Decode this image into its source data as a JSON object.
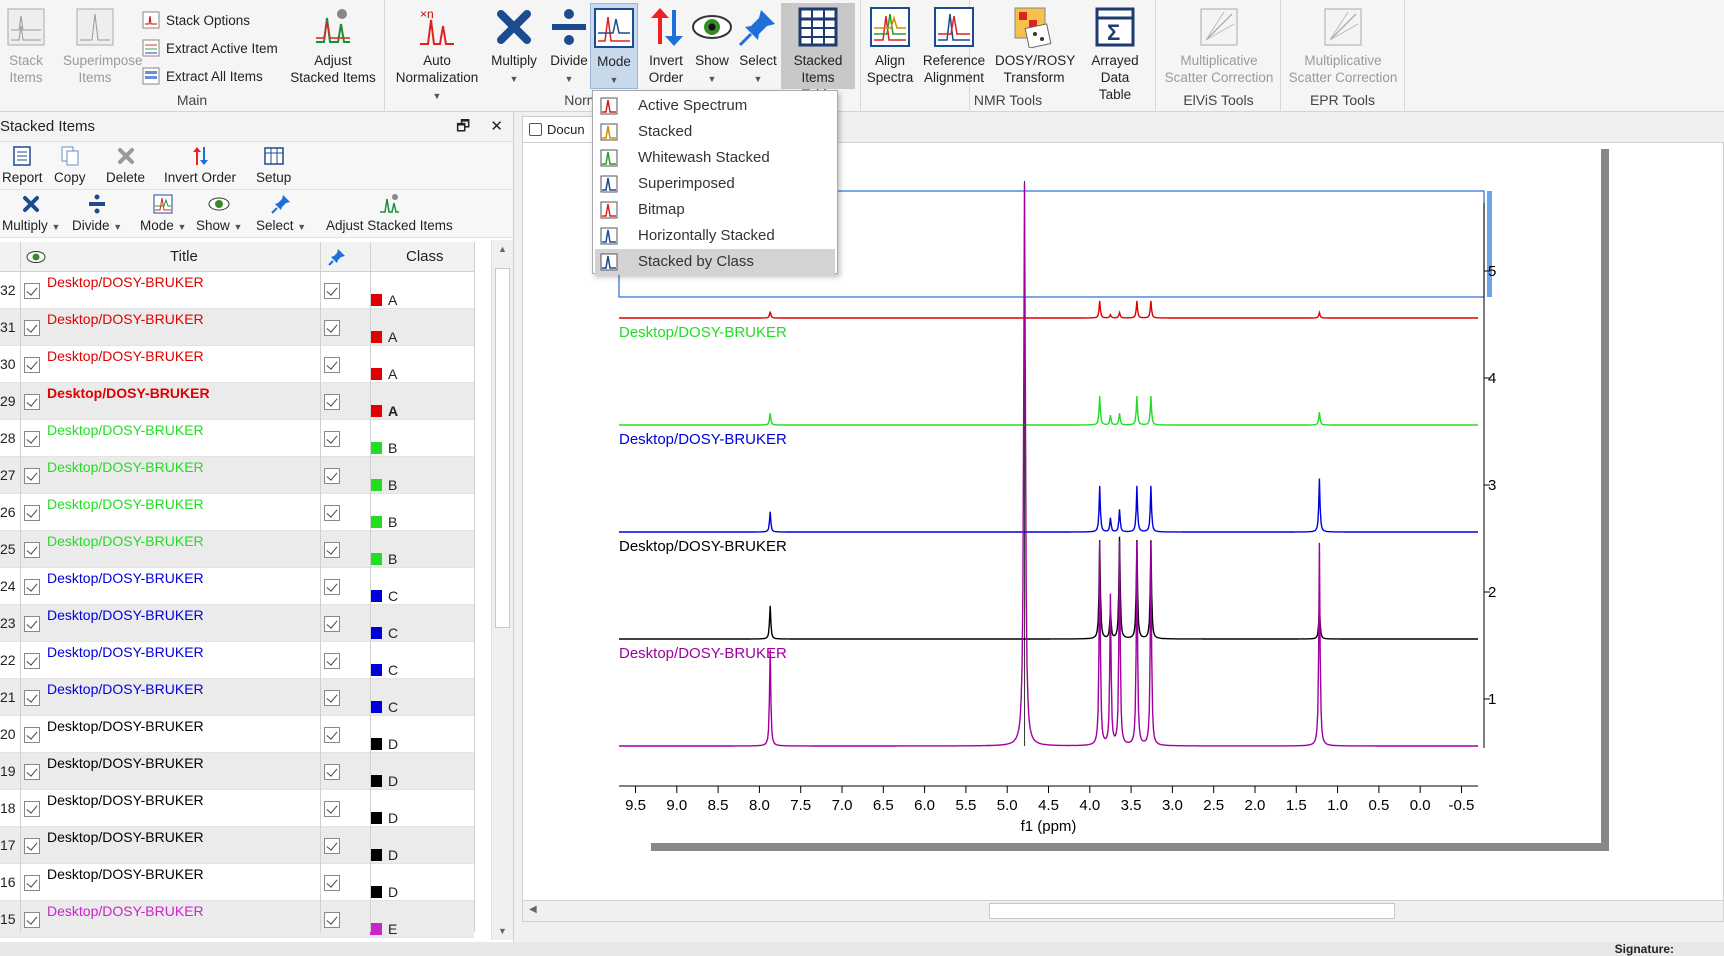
{
  "ribbon": {
    "main_group": {
      "label": "Main",
      "stack_items": "Stack Items",
      "superimpose_items": "Superimpose Items",
      "stack_options": "Stack Options",
      "extract_active_item": "Extract Active Item",
      "extract_all_items": "Extract All Items",
      "adjust_stacked_items": "Adjust Stacked Items"
    },
    "normalization_group": {
      "label": "Normalization",
      "auto_normalization": "Auto Normalization",
      "multiply": "Multiply",
      "divide": "Divide"
    },
    "mode": "Mode",
    "invert_order": "Invert Order",
    "show": "Show",
    "select": "Select",
    "stacked_items_table": "Stacked Items Table",
    "nmr_group": {
      "label": "NMR Tools",
      "align_spectra": "Align Spectra",
      "reference_alignment": "Reference Alignment",
      "dosy_rosy": "DOSY/ROSY Transform",
      "arrayed_data_table": "Arrayed Data Table"
    },
    "elvis_group": {
      "label": "ElViS Tools",
      "msc": "Multiplicative Scatter Correction"
    },
    "epr_group": {
      "label": "EPR Tools",
      "msc": "Multiplicative Scatter Correction"
    }
  },
  "mode_menu": {
    "items": [
      {
        "label": "Active Spectrum",
        "icon": "active-spectrum-icon"
      },
      {
        "label": "Stacked",
        "icon": "stacked-icon"
      },
      {
        "label": "Whitewash Stacked",
        "icon": "whitewash-stacked-icon"
      },
      {
        "label": "Superimposed",
        "icon": "superimposed-icon"
      },
      {
        "label": "Bitmap",
        "icon": "bitmap-icon"
      },
      {
        "label": "Horizontally Stacked",
        "icon": "horizontally-stacked-icon"
      },
      {
        "label": "Stacked by Class",
        "icon": "stacked-by-class-icon",
        "selected": true
      }
    ]
  },
  "panel": {
    "title": "Stacked Items",
    "toolbar1": {
      "report": "Report",
      "copy": "Copy",
      "delete": "Delete",
      "invert_order": "Invert Order",
      "setup": "Setup"
    },
    "toolbar2": {
      "multiply": "Multiply",
      "divide": "Divide",
      "mode": "Mode",
      "show": "Show",
      "select": "Select",
      "adjust": "Adjust Stacked Items"
    },
    "columns": {
      "title": "Title",
      "class": "Class"
    }
  },
  "rows": [
    {
      "num": "32",
      "title": "Desktop/DOSY-BRUKER",
      "color": "#e00000",
      "cls": "A",
      "bold": false
    },
    {
      "num": "31",
      "title": "Desktop/DOSY-BRUKER",
      "color": "#e00000",
      "cls": "A",
      "bold": false
    },
    {
      "num": "30",
      "title": "Desktop/DOSY-BRUKER",
      "color": "#e00000",
      "cls": "A",
      "bold": false
    },
    {
      "num": "29",
      "title": "Desktop/DOSY-BRUKER",
      "color": "#e00000",
      "cls": "A",
      "bold": true
    },
    {
      "num": "28",
      "title": "Desktop/DOSY-BRUKER",
      "color": "#22dd22",
      "cls": "B",
      "bold": false
    },
    {
      "num": "27",
      "title": "Desktop/DOSY-BRUKER",
      "color": "#22dd22",
      "cls": "B",
      "bold": false
    },
    {
      "num": "26",
      "title": "Desktop/DOSY-BRUKER",
      "color": "#22dd22",
      "cls": "B",
      "bold": false
    },
    {
      "num": "25",
      "title": "Desktop/DOSY-BRUKER",
      "color": "#22dd22",
      "cls": "B",
      "bold": false
    },
    {
      "num": "24",
      "title": "Desktop/DOSY-BRUKER",
      "color": "#0000dd",
      "cls": "C",
      "bold": false
    },
    {
      "num": "23",
      "title": "Desktop/DOSY-BRUKER",
      "color": "#0000dd",
      "cls": "C",
      "bold": false
    },
    {
      "num": "22",
      "title": "Desktop/DOSY-BRUKER",
      "color": "#0000dd",
      "cls": "C",
      "bold": false
    },
    {
      "num": "21",
      "title": "Desktop/DOSY-BRUKER",
      "color": "#0000dd",
      "cls": "C",
      "bold": false
    },
    {
      "num": "20",
      "title": "Desktop/DOSY-BRUKER",
      "color": "#000000",
      "cls": "D",
      "bold": false
    },
    {
      "num": "19",
      "title": "Desktop/DOSY-BRUKER",
      "color": "#000000",
      "cls": "D",
      "bold": false
    },
    {
      "num": "18",
      "title": "Desktop/DOSY-BRUKER",
      "color": "#000000",
      "cls": "D",
      "bold": false
    },
    {
      "num": "17",
      "title": "Desktop/DOSY-BRUKER",
      "color": "#000000",
      "cls": "D",
      "bold": false
    },
    {
      "num": "16",
      "title": "Desktop/DOSY-BRUKER",
      "color": "#000000",
      "cls": "D",
      "bold": false
    },
    {
      "num": "15",
      "title": "Desktop/DOSY-BRUKER",
      "color": "#cc22cc",
      "cls": "E",
      "bold": false
    }
  ],
  "doc": {
    "tab_label": "Docun"
  },
  "status": {
    "signature": "Signature:"
  },
  "chart_data": {
    "type": "line",
    "xlabel": "f1 (ppm)",
    "x_ticks": [
      "9.5",
      "9.0",
      "8.5",
      "8.0",
      "7.5",
      "7.0",
      "6.5",
      "6.0",
      "5.5",
      "5.0",
      "4.5",
      "4.0",
      "3.5",
      "3.0",
      "2.5",
      "2.0",
      "1.5",
      "1.0",
      "0.5",
      "0.0",
      "-0.5"
    ],
    "xlim": [
      9.7,
      -0.7
    ],
    "y_ticks": [
      "5",
      "4",
      "3",
      "2",
      "1"
    ],
    "peaks_ppm": [
      7.87,
      4.79,
      3.88,
      3.75,
      3.64,
      3.43,
      3.26,
      1.22
    ],
    "series": [
      {
        "name": "Desktop/DOSY-BRUKER",
        "color": "#e00000",
        "level": 5,
        "heights": [
          0.06,
          0.0,
          0.16,
          0.03,
          0.05,
          0.16,
          0.16,
          0.05
        ]
      },
      {
        "name": "Desktop/DOSY-BRUKER",
        "color": "#22dd22",
        "level": 4,
        "heights": [
          0.11,
          0.0,
          0.27,
          0.09,
          0.11,
          0.27,
          0.27,
          0.12
        ]
      },
      {
        "name": "Desktop/DOSY-BRUKER",
        "color": "#0000dd",
        "level": 3,
        "heights": [
          0.19,
          0.0,
          0.43,
          0.13,
          0.21,
          0.43,
          0.43,
          0.5
        ]
      },
      {
        "name": "Desktop/DOSY-BRUKER",
        "color": "#000000",
        "level": 2,
        "heights": [
          0.31,
          0.0,
          0.92,
          0.27,
          0.95,
          0.92,
          0.92,
          0.31
        ]
      },
      {
        "name": "Desktop/DOSY-BRUKER",
        "color": "#a000a0",
        "level": 1,
        "heights": [
          0.9,
          5.5,
          1.9,
          1.4,
          1.9,
          1.9,
          1.9,
          1.9
        ]
      }
    ]
  }
}
